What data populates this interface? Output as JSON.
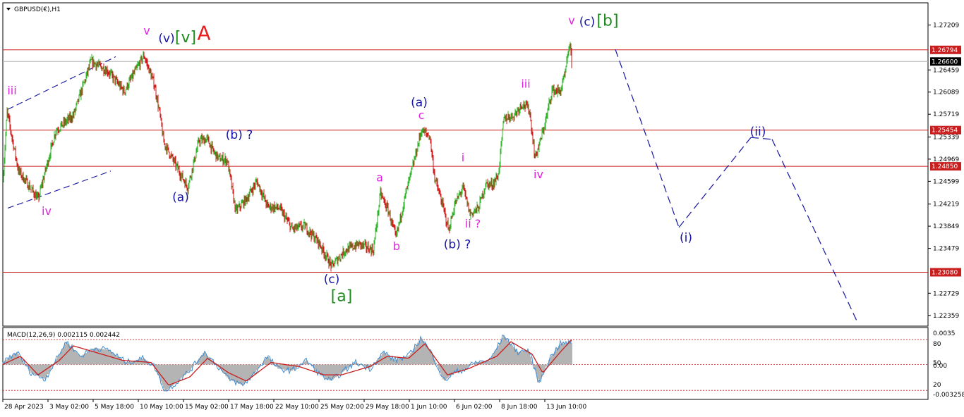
{
  "symbol_title": "GBPUSD(€),H1",
  "macd_title": "MACD(12,26,9) 0.002115 0.002442",
  "colors": {
    "bull": "#2fb52a",
    "bear": "#d11a1a",
    "hline": "#c81e1e",
    "current": "#b4b4b4",
    "wave_blue": "#1414a0",
    "wave_magenta": "#e020e0",
    "wave_green": "#1f8c1f",
    "wave_red": "#e61e1e",
    "macd_line": "#3c8cd2",
    "signal_line": "#c81e1e",
    "histogram": "#b4b4b4"
  },
  "price_axis": {
    "ticks": [
      "1.27209",
      "1.26459",
      "1.26089",
      "1.25719",
      "1.25339",
      "1.24969",
      "1.24599",
      "1.24219",
      "1.23849",
      "1.23479",
      "1.22729",
      "1.22359"
    ],
    "levels": [
      {
        "label": "1.26794",
        "kind": "resistance"
      },
      {
        "label": "1.26600",
        "kind": "current"
      },
      {
        "label": "1.25454",
        "kind": "resistance"
      },
      {
        "label": "1.24850",
        "kind": "resistance"
      },
      {
        "label": "1.23080",
        "kind": "support"
      }
    ]
  },
  "macd_axis": {
    "ticks": [
      "0.0035",
      "80",
      "50",
      "0.00",
      "20",
      "-0.003258"
    ]
  },
  "time_axis": {
    "labels": [
      "28 Apr 2023",
      "3 May 02:00",
      "5 May 18:00",
      "10 May 10:00",
      "15 May 02:00",
      "17 May 18:00",
      "22 May 10:00",
      "25 May 02:00",
      "29 May 18:00",
      "1 Jun 10:00",
      "6 Jun 02:00",
      "8 Jun 18:00",
      "13 Jun 10:00"
    ]
  },
  "chart_data": {
    "type": "candlestick",
    "symbol": "GBPUSD",
    "timeframe": "H1",
    "x_start": "28 Apr 2023",
    "x_end": "13 Jun 2023",
    "y_range": [
      1.2218,
      1.2758
    ],
    "horizontal_levels": [
      1.26794,
      1.266,
      1.25454,
      1.2485,
      1.2308
    ],
    "price_path": [
      {
        "bar": 0,
        "price": 1.246
      },
      {
        "bar": 6,
        "price": 1.2576
      },
      {
        "bar": 22,
        "price": 1.2478
      },
      {
        "bar": 50,
        "price": 1.243
      },
      {
        "bar": 75,
        "price": 1.2545
      },
      {
        "bar": 100,
        "price": 1.257
      },
      {
        "bar": 125,
        "price": 1.266
      },
      {
        "bar": 148,
        "price": 1.2645
      },
      {
        "bar": 172,
        "price": 1.261
      },
      {
        "bar": 200,
        "price": 1.267
      },
      {
        "bar": 215,
        "price": 1.262
      },
      {
        "bar": 222,
        "price": 1.2575
      },
      {
        "bar": 228,
        "price": 1.2525
      },
      {
        "bar": 245,
        "price": 1.2487
      },
      {
        "bar": 262,
        "price": 1.245
      },
      {
        "bar": 278,
        "price": 1.2528
      },
      {
        "bar": 290,
        "price": 1.253
      },
      {
        "bar": 298,
        "price": 1.251
      },
      {
        "bar": 306,
        "price": 1.2498
      },
      {
        "bar": 318,
        "price": 1.2495
      },
      {
        "bar": 330,
        "price": 1.241
      },
      {
        "bar": 345,
        "price": 1.243
      },
      {
        "bar": 360,
        "price": 1.246
      },
      {
        "bar": 375,
        "price": 1.2418
      },
      {
        "bar": 392,
        "price": 1.2415
      },
      {
        "bar": 410,
        "price": 1.238
      },
      {
        "bar": 428,
        "price": 1.2385
      },
      {
        "bar": 448,
        "price": 1.2357
      },
      {
        "bar": 466,
        "price": 1.2318
      },
      {
        "bar": 485,
        "price": 1.2345
      },
      {
        "bar": 505,
        "price": 1.2355
      },
      {
        "bar": 525,
        "price": 1.2345
      },
      {
        "bar": 535,
        "price": 1.244
      },
      {
        "bar": 547,
        "price": 1.2408
      },
      {
        "bar": 557,
        "price": 1.2365
      },
      {
        "bar": 570,
        "price": 1.2435
      },
      {
        "bar": 582,
        "price": 1.249
      },
      {
        "bar": 593,
        "price": 1.2545
      },
      {
        "bar": 605,
        "price": 1.2535
      },
      {
        "bar": 612,
        "price": 1.2465
      },
      {
        "bar": 622,
        "price": 1.2425
      },
      {
        "bar": 632,
        "price": 1.2378
      },
      {
        "bar": 640,
        "price": 1.242
      },
      {
        "bar": 652,
        "price": 1.245
      },
      {
        "bar": 662,
        "price": 1.2405
      },
      {
        "bar": 674,
        "price": 1.2415
      },
      {
        "bar": 684,
        "price": 1.2455
      },
      {
        "bar": 694,
        "price": 1.2455
      },
      {
        "bar": 702,
        "price": 1.247
      },
      {
        "bar": 710,
        "price": 1.2565
      },
      {
        "bar": 724,
        "price": 1.257
      },
      {
        "bar": 736,
        "price": 1.259
      },
      {
        "bar": 746,
        "price": 1.258
      },
      {
        "bar": 754,
        "price": 1.25
      },
      {
        "bar": 760,
        "price": 1.252
      },
      {
        "bar": 770,
        "price": 1.2565
      },
      {
        "bar": 778,
        "price": 1.2612
      },
      {
        "bar": 790,
        "price": 1.261
      },
      {
        "bar": 797,
        "price": 1.264
      },
      {
        "bar": 803,
        "price": 1.269
      },
      {
        "bar": 806,
        "price": 1.266
      }
    ],
    "projection_path": [
      {
        "bar": 868,
        "price": 1.268
      },
      {
        "bar": 958,
        "price": 1.2383
      },
      {
        "bar": 1060,
        "price": 1.2533
      },
      {
        "bar": 1090,
        "price": 1.253
      },
      {
        "bar": 1212,
        "price": 1.2222
      }
    ],
    "channel_lines": [
      [
        {
          "bar": 7,
          "price": 1.258
        },
        {
          "bar": 160,
          "price": 1.2668
        }
      ],
      [
        {
          "bar": 7,
          "price": 1.2415
        },
        {
          "bar": 153,
          "price": 1.2477
        }
      ]
    ],
    "wave_labels": [
      {
        "text": "iii",
        "bar": 13,
        "price": 1.2605,
        "color": "magenta"
      },
      {
        "text": "iv",
        "bar": 62,
        "price": 1.2404,
        "color": "magenta"
      },
      {
        "text": "v",
        "bar": 204,
        "price": 1.2705,
        "color": "magenta"
      },
      {
        "text": "(v)",
        "bar": 232,
        "price": 1.2692,
        "color": "blue"
      },
      {
        "text": "[v]",
        "bar": 259,
        "price": 1.2692,
        "color": "green"
      },
      {
        "text": "A",
        "bar": 285,
        "price": 1.2696,
        "color": "red"
      },
      {
        "text": "(a)",
        "bar": 252,
        "price": 1.2427,
        "color": "blue"
      },
      {
        "text": "(b) ?",
        "bar": 335,
        "price": 1.2531,
        "color": "blue"
      },
      {
        "text": "(c)",
        "bar": 466,
        "price": 1.229,
        "color": "blue"
      },
      {
        "text": "[a]",
        "bar": 480,
        "price": 1.226,
        "color": "green"
      },
      {
        "text": "a",
        "bar": 534,
        "price": 1.246,
        "color": "magenta"
      },
      {
        "text": "b",
        "bar": 558,
        "price": 1.2345,
        "color": "magenta"
      },
      {
        "text": "c",
        "bar": 593,
        "price": 1.2564,
        "color": "magenta"
      },
      {
        "text": "(a)",
        "bar": 590,
        "price": 1.2585,
        "color": "blue"
      },
      {
        "text": "(b) ?",
        "bar": 644,
        "price": 1.2348,
        "color": "blue"
      },
      {
        "text": "i",
        "bar": 652,
        "price": 1.2493,
        "color": "magenta"
      },
      {
        "text": "ii ?",
        "bar": 666,
        "price": 1.2383,
        "color": "magenta"
      },
      {
        "text": "iii",
        "bar": 741,
        "price": 1.2616,
        "color": "magenta"
      },
      {
        "text": "iv",
        "bar": 759,
        "price": 1.2465,
        "color": "magenta"
      },
      {
        "text": "v",
        "bar": 806,
        "price": 1.2722,
        "color": "magenta"
      },
      {
        "text": "(c)",
        "bar": 828,
        "price": 1.272,
        "color": "blue"
      },
      {
        "text": "[b]",
        "bar": 857,
        "price": 1.272,
        "color": "green"
      },
      {
        "text": "(i)",
        "bar": 968,
        "price": 1.2359,
        "color": "blue"
      },
      {
        "text": "(ii)",
        "bar": 1070,
        "price": 1.2536,
        "color": "blue"
      }
    ],
    "macd": {
      "main_path": [
        {
          "bar": 0,
          "value": 0.0002
        },
        {
          "bar": 20,
          "value": 0.0012
        },
        {
          "bar": 40,
          "value": -0.0008
        },
        {
          "bar": 60,
          "value": -0.0014
        },
        {
          "bar": 75,
          "value": 0.0004
        },
        {
          "bar": 90,
          "value": 0.0022
        },
        {
          "bar": 110,
          "value": 0.0008
        },
        {
          "bar": 130,
          "value": 0.0016
        },
        {
          "bar": 150,
          "value": 0.0014
        },
        {
          "bar": 175,
          "value": 0.0002
        },
        {
          "bar": 200,
          "value": 0.0006
        },
        {
          "bar": 215,
          "value": -0.0002
        },
        {
          "bar": 230,
          "value": -0.0026
        },
        {
          "bar": 245,
          "value": -0.0018
        },
        {
          "bar": 265,
          "value": -0.0006
        },
        {
          "bar": 285,
          "value": 0.0012
        },
        {
          "bar": 300,
          "value": 0.0002
        },
        {
          "bar": 320,
          "value": -0.0014
        },
        {
          "bar": 340,
          "value": -0.002
        },
        {
          "bar": 355,
          "value": -0.001
        },
        {
          "bar": 375,
          "value": 0.0008
        },
        {
          "bar": 390,
          "value": -0.0004
        },
        {
          "bar": 410,
          "value": -0.0006
        },
        {
          "bar": 430,
          "value": 0.0004
        },
        {
          "bar": 450,
          "value": -0.001
        },
        {
          "bar": 465,
          "value": -0.0016
        },
        {
          "bar": 480,
          "value": -0.0008
        },
        {
          "bar": 500,
          "value": 0.0002
        },
        {
          "bar": 520,
          "value": -0.0004
        },
        {
          "bar": 540,
          "value": 0.0012
        },
        {
          "bar": 555,
          "value": 0.0004
        },
        {
          "bar": 575,
          "value": 0.0008
        },
        {
          "bar": 593,
          "value": 0.0026
        },
        {
          "bar": 610,
          "value": 0.0008
        },
        {
          "bar": 625,
          "value": -0.0016
        },
        {
          "bar": 640,
          "value": -0.0008
        },
        {
          "bar": 655,
          "value": -0.0004
        },
        {
          "bar": 670,
          "value": 0.0002
        },
        {
          "bar": 690,
          "value": 0.0004
        },
        {
          "bar": 710,
          "value": 0.0028
        },
        {
          "bar": 730,
          "value": 0.0012
        },
        {
          "bar": 745,
          "value": 0.0014
        },
        {
          "bar": 760,
          "value": -0.0018
        },
        {
          "bar": 775,
          "value": 0.0006
        },
        {
          "bar": 790,
          "value": 0.002
        },
        {
          "bar": 806,
          "value": 0.0021
        }
      ],
      "signal_path": [
        {
          "bar": 0,
          "value": 0.0
        },
        {
          "bar": 25,
          "value": 0.0008
        },
        {
          "bar": 50,
          "value": -0.001
        },
        {
          "bar": 80,
          "value": 0.0004
        },
        {
          "bar": 100,
          "value": 0.0018
        },
        {
          "bar": 130,
          "value": 0.0012
        },
        {
          "bar": 170,
          "value": 0.0004
        },
        {
          "bar": 210,
          "value": 0.0002
        },
        {
          "bar": 235,
          "value": -0.002
        },
        {
          "bar": 265,
          "value": -0.0012
        },
        {
          "bar": 290,
          "value": 0.0006
        },
        {
          "bar": 320,
          "value": -0.0008
        },
        {
          "bar": 345,
          "value": -0.0016
        },
        {
          "bar": 380,
          "value": 0.0002
        },
        {
          "bar": 420,
          "value": -0.0002
        },
        {
          "bar": 455,
          "value": -0.001
        },
        {
          "bar": 480,
          "value": -0.001
        },
        {
          "bar": 520,
          "value": -0.0002
        },
        {
          "bar": 545,
          "value": 0.0008
        },
        {
          "bar": 575,
          "value": 0.0006
        },
        {
          "bar": 598,
          "value": 0.002
        },
        {
          "bar": 630,
          "value": -0.001
        },
        {
          "bar": 660,
          "value": -0.0004
        },
        {
          "bar": 700,
          "value": 0.0008
        },
        {
          "bar": 720,
          "value": 0.0022
        },
        {
          "bar": 750,
          "value": 0.001
        },
        {
          "bar": 765,
          "value": -0.0008
        },
        {
          "bar": 790,
          "value": 0.0012
        },
        {
          "bar": 806,
          "value": 0.0024
        }
      ],
      "y_range": [
        -0.0033,
        0.0035
      ],
      "level_lines": [
        0.0024,
        0.0,
        -0.0025
      ]
    }
  }
}
